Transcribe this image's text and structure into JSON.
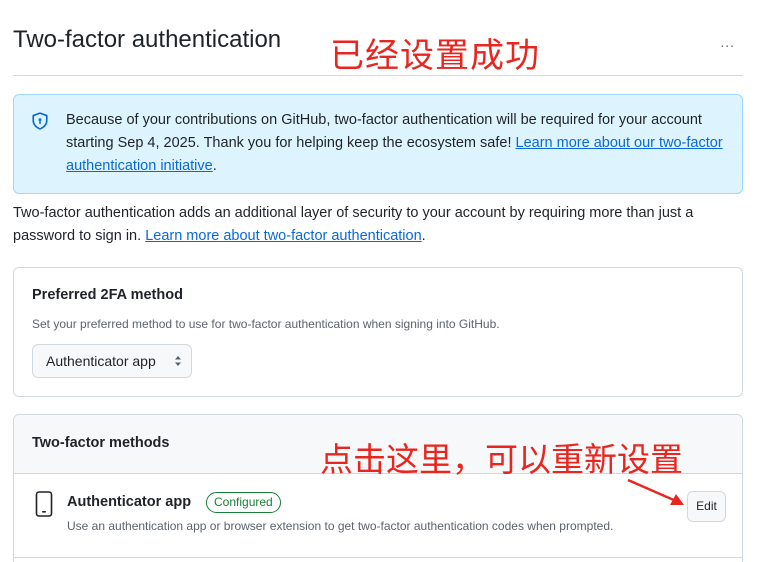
{
  "header": {
    "title": "Two-factor authentication",
    "more_label": "..."
  },
  "annotations": {
    "top": "已经设置成功",
    "middle": "点击这里，可以重新设置",
    "color": "#e8261f"
  },
  "banner": {
    "icon": "shield-icon",
    "text": "Because of your contributions on GitHub, two-factor authentication will be required for your account starting Sep 4, 2025. Thank you for helping keep the ecosystem safe! ",
    "link_label": "Learn more about our two-factor authentication initiative",
    "end": "."
  },
  "intro": {
    "text": "Two-factor authentication adds an additional layer of security to your account by requiring more than just a password to sign in. ",
    "link_label": "Learn more about two-factor authentication",
    "end": "."
  },
  "preferred": {
    "heading": "Preferred 2FA method",
    "description": "Set your preferred method to use for two-factor authentication when signing into GitHub.",
    "selected": "Authenticator app"
  },
  "methods": {
    "heading": "Two-factor methods",
    "items": [
      {
        "icon": "device-mobile-icon",
        "title": "Authenticator app",
        "badge": "Configured",
        "description": "Use an authentication app or browser extension to get two-factor authentication codes when prompted.",
        "action": "Edit"
      }
    ]
  },
  "colors": {
    "link": "#0969da",
    "success": "#1a7f37",
    "banner_bg": "#ddf4ff"
  }
}
